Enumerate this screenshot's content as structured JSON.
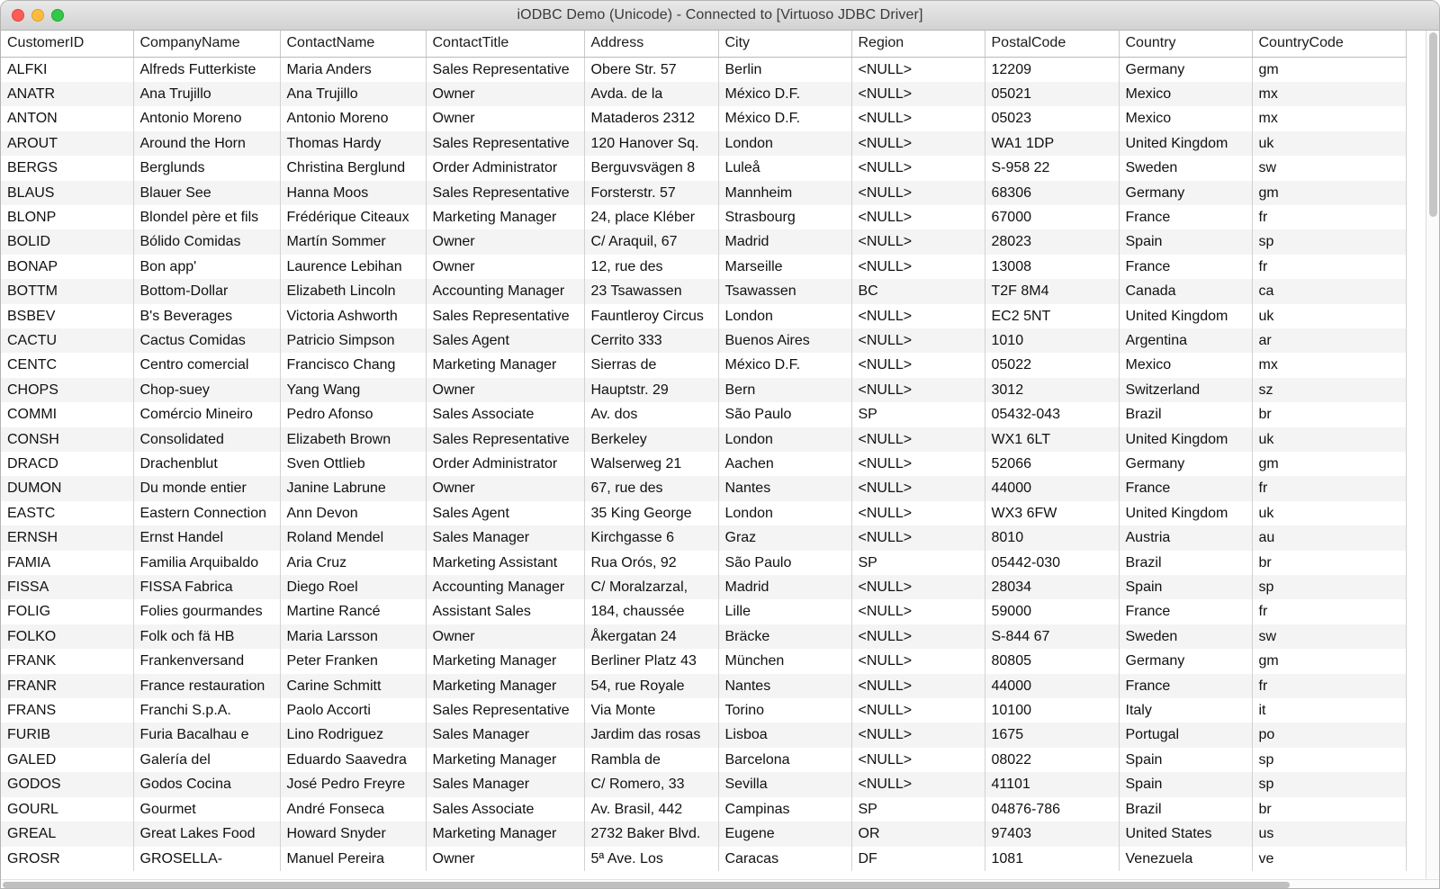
{
  "window": {
    "title": "iODBC Demo (Unicode) - Connected to [Virtuoso JDBC Driver]",
    "controls": {
      "close_label": "",
      "minimize_label": "",
      "maximize_label": ""
    },
    "accent_colors": {
      "close": "#fc5b57",
      "minimize": "#fdbc40",
      "maximize": "#34c749",
      "titlebar": "#dcdcdc",
      "row_alt": "#f4f4f4",
      "grid_line": "#d2d2d2"
    }
  },
  "table": {
    "columns": [
      "CustomerID",
      "CompanyName",
      "ContactName",
      "ContactTitle",
      "Address",
      "City",
      "Region",
      "PostalCode",
      "Country",
      "CountryCode"
    ],
    "rows": [
      [
        "ALFKI",
        "Alfreds Futterkiste",
        "Maria Anders",
        "Sales Representative",
        "Obere Str. 57",
        "Berlin",
        "<NULL>",
        "12209",
        "Germany",
        "gm"
      ],
      [
        "ANATR",
        "Ana Trujillo",
        "Ana Trujillo",
        "Owner",
        "Avda. de la",
        "México D.F.",
        "<NULL>",
        "05021",
        "Mexico",
        "mx"
      ],
      [
        "ANTON",
        "Antonio Moreno",
        "Antonio Moreno",
        "Owner",
        "Mataderos  2312",
        "México D.F.",
        "<NULL>",
        "05023",
        "Mexico",
        "mx"
      ],
      [
        "AROUT",
        "Around the Horn",
        "Thomas Hardy",
        "Sales Representative",
        "120 Hanover Sq.",
        "London",
        "<NULL>",
        "WA1 1DP",
        "United Kingdom",
        "uk"
      ],
      [
        "BERGS",
        "Berglunds",
        "Christina Berglund",
        "Order Administrator",
        "Berguvsvägen  8",
        "Luleå",
        "<NULL>",
        "S-958 22",
        "Sweden",
        "sw"
      ],
      [
        "BLAUS",
        "Blauer See",
        "Hanna Moos",
        "Sales Representative",
        "Forsterstr. 57",
        "Mannheim",
        "<NULL>",
        "68306",
        "Germany",
        "gm"
      ],
      [
        "BLONP",
        "Blondel père et fils",
        "Frédérique Citeaux",
        "Marketing Manager",
        "24, place Kléber",
        "Strasbourg",
        "<NULL>",
        "67000",
        "France",
        "fr"
      ],
      [
        "BOLID",
        "Bólido Comidas",
        "Martín Sommer",
        "Owner",
        "C/ Araquil, 67",
        "Madrid",
        "<NULL>",
        "28023",
        "Spain",
        "sp"
      ],
      [
        "BONAP",
        "Bon app'",
        "Laurence Lebihan",
        "Owner",
        "12, rue des",
        "Marseille",
        "<NULL>",
        "13008",
        "France",
        "fr"
      ],
      [
        "BOTTM",
        "Bottom-Dollar",
        "Elizabeth Lincoln",
        "Accounting Manager",
        "23 Tsawassen",
        "Tsawassen",
        "BC",
        "T2F 8M4",
        "Canada",
        "ca"
      ],
      [
        "BSBEV",
        "B's Beverages",
        "Victoria Ashworth",
        "Sales Representative",
        "Fauntleroy Circus",
        "London",
        "<NULL>",
        "EC2 5NT",
        "United Kingdom",
        "uk"
      ],
      [
        "CACTU",
        "Cactus Comidas",
        "Patricio Simpson",
        "Sales Agent",
        "Cerrito 333",
        "Buenos Aires",
        "<NULL>",
        "1010",
        "Argentina",
        "ar"
      ],
      [
        "CENTC",
        "Centro comercial",
        "Francisco Chang",
        "Marketing Manager",
        "Sierras de",
        "México D.F.",
        "<NULL>",
        "05022",
        "Mexico",
        "mx"
      ],
      [
        "CHOPS",
        "Chop-suey",
        "Yang Wang",
        "Owner",
        "Hauptstr. 29",
        "Bern",
        "<NULL>",
        "3012",
        "Switzerland",
        "sz"
      ],
      [
        "COMMI",
        "Comércio Mineiro",
        "Pedro Afonso",
        "Sales Associate",
        "Av. dos",
        "São Paulo",
        "SP",
        "05432-043",
        "Brazil",
        "br"
      ],
      [
        "CONSH",
        "Consolidated",
        "Elizabeth Brown",
        "Sales Representative",
        "Berkeley",
        "London",
        "<NULL>",
        "WX1 6LT",
        "United Kingdom",
        "uk"
      ],
      [
        "DRACD",
        "Drachenblut",
        "Sven Ottlieb",
        "Order Administrator",
        "Walserweg 21",
        "Aachen",
        "<NULL>",
        "52066",
        "Germany",
        "gm"
      ],
      [
        "DUMON",
        "Du monde entier",
        "Janine Labrune",
        "Owner",
        "67, rue des",
        "Nantes",
        "<NULL>",
        "44000",
        "France",
        "fr"
      ],
      [
        "EASTC",
        "Eastern Connection",
        "Ann Devon",
        "Sales Agent",
        "35 King George",
        "London",
        "<NULL>",
        "WX3 6FW",
        "United Kingdom",
        "uk"
      ],
      [
        "ERNSH",
        "Ernst Handel",
        "Roland Mendel",
        "Sales Manager",
        "Kirchgasse 6",
        "Graz",
        "<NULL>",
        "8010",
        "Austria",
        "au"
      ],
      [
        "FAMIA",
        "Familia Arquibaldo",
        "Aria Cruz",
        "Marketing Assistant",
        "Rua Orós, 92",
        "São Paulo",
        "SP",
        "05442-030",
        "Brazil",
        "br"
      ],
      [
        "FISSA",
        "FISSA Fabrica",
        "Diego Roel",
        "Accounting Manager",
        "C/ Moralzarzal,",
        "Madrid",
        "<NULL>",
        "28034",
        "Spain",
        "sp"
      ],
      [
        "FOLIG",
        "Folies gourmandes",
        "Martine Rancé",
        "Assistant Sales",
        "184, chaussée",
        "Lille",
        "<NULL>",
        "59000",
        "France",
        "fr"
      ],
      [
        "FOLKO",
        "Folk och fä HB",
        "Maria Larsson",
        "Owner",
        "Åkergatan 24",
        "Bräcke",
        "<NULL>",
        "S-844 67",
        "Sweden",
        "sw"
      ],
      [
        "FRANK",
        "Frankenversand",
        "Peter Franken",
        "Marketing Manager",
        "Berliner Platz 43",
        "München",
        "<NULL>",
        "80805",
        "Germany",
        "gm"
      ],
      [
        "FRANR",
        "France restauration",
        "Carine Schmitt",
        "Marketing Manager",
        "54, rue Royale",
        "Nantes",
        "<NULL>",
        "44000",
        "France",
        "fr"
      ],
      [
        "FRANS",
        "Franchi S.p.A.",
        "Paolo Accorti",
        "Sales Representative",
        "Via Monte",
        "Torino",
        "<NULL>",
        "10100",
        "Italy",
        "it"
      ],
      [
        "FURIB",
        "Furia Bacalhau e",
        "Lino Rodriguez",
        "Sales Manager",
        "Jardim das rosas",
        "Lisboa",
        "<NULL>",
        "1675",
        "Portugal",
        "po"
      ],
      [
        "GALED",
        "Galería del",
        "Eduardo Saavedra",
        "Marketing Manager",
        "Rambla de",
        "Barcelona",
        "<NULL>",
        "08022",
        "Spain",
        "sp"
      ],
      [
        "GODOS",
        "Godos Cocina",
        "José Pedro Freyre",
        "Sales Manager",
        "C/ Romero, 33",
        "Sevilla",
        "<NULL>",
        "41101",
        "Spain",
        "sp"
      ],
      [
        "GOURL",
        "Gourmet",
        "André Fonseca",
        "Sales Associate",
        "Av. Brasil, 442",
        "Campinas",
        "SP",
        "04876-786",
        "Brazil",
        "br"
      ],
      [
        "GREAL",
        "Great Lakes Food",
        "Howard Snyder",
        "Marketing Manager",
        "2732 Baker Blvd.",
        "Eugene",
        "OR",
        "97403",
        "United States",
        "us"
      ],
      [
        "GROSR",
        "GROSELLA-",
        "Manuel Pereira",
        "Owner",
        "5ª Ave. Los",
        "Caracas",
        "DF",
        "1081",
        "Venezuela",
        "ve"
      ]
    ]
  }
}
